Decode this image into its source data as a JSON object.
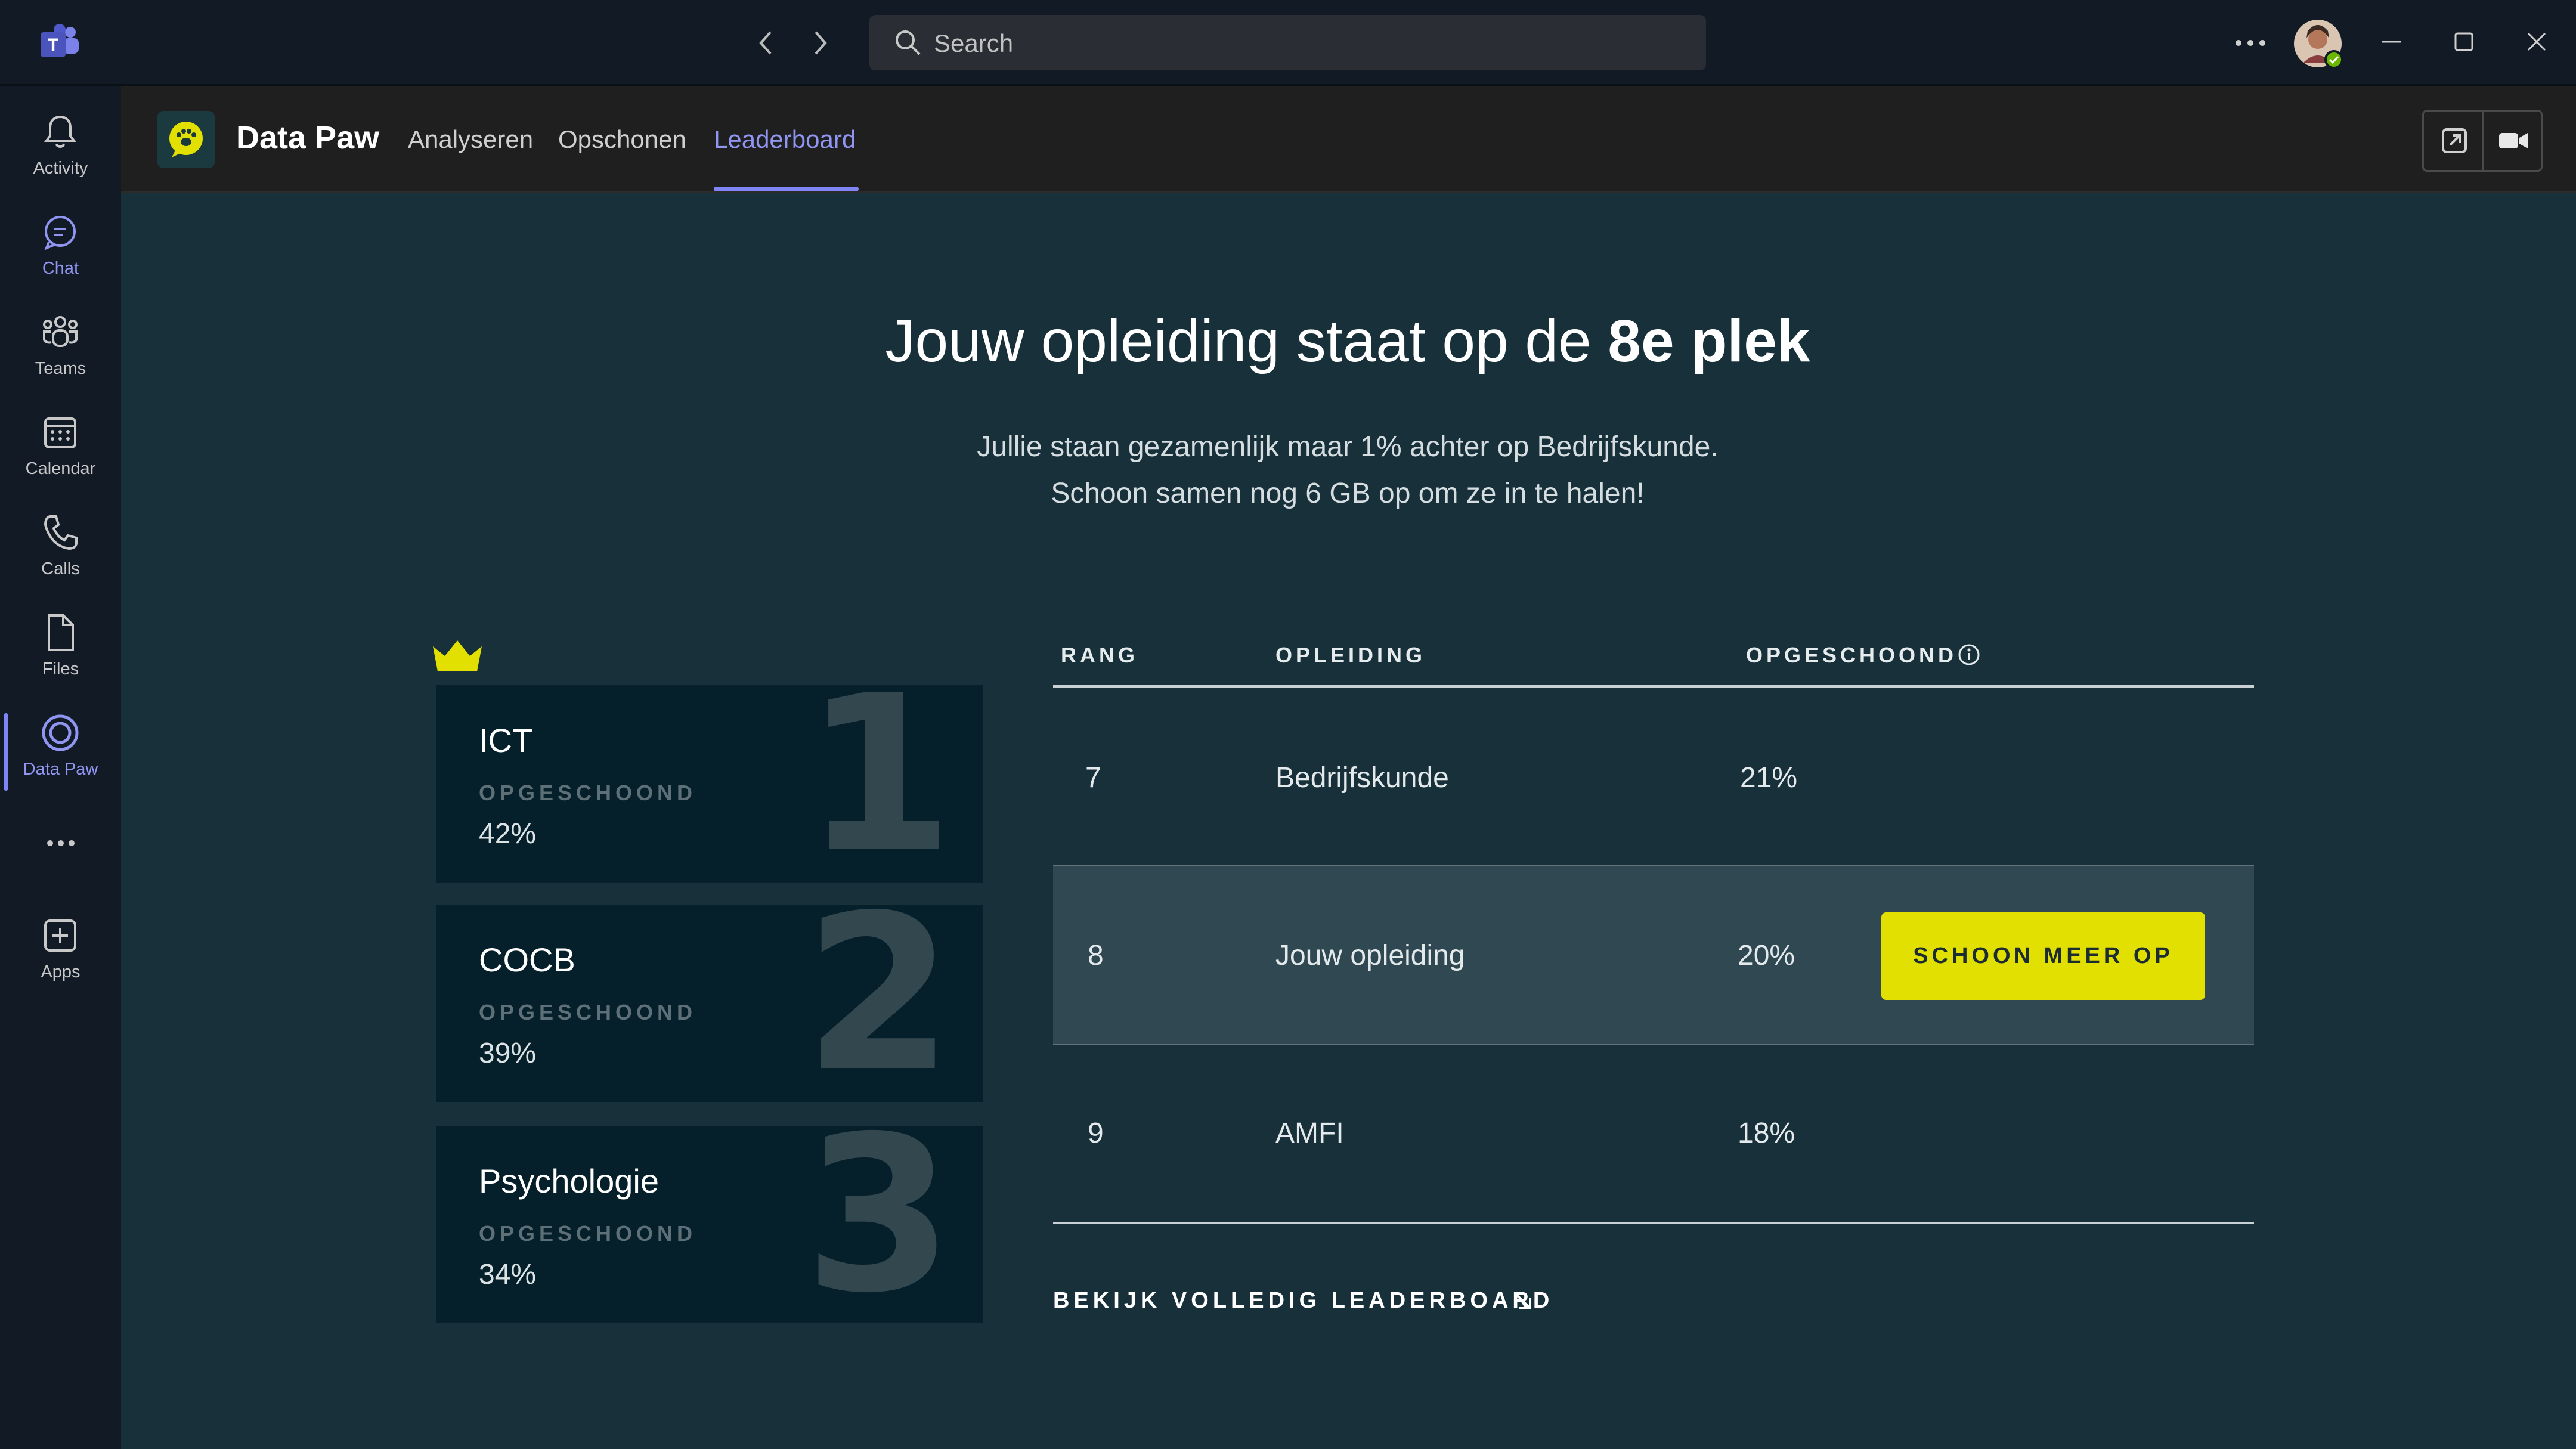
{
  "titlebar": {
    "search_placeholder": "Search",
    "icons": [
      "teams-logo-icon",
      "back-arrow-icon",
      "forward-arrow-icon",
      "search-icon",
      "more-icon",
      "avatar",
      "minimize-icon",
      "maximize-icon",
      "close-icon"
    ]
  },
  "rail": {
    "items": [
      {
        "label": "Activity",
        "icon": "bell-icon"
      },
      {
        "label": "Chat",
        "icon": "chat-icon"
      },
      {
        "label": "Teams",
        "icon": "teams-icon"
      },
      {
        "label": "Calendar",
        "icon": "calendar-icon"
      },
      {
        "label": "Calls",
        "icon": "phone-icon"
      },
      {
        "label": "Files",
        "icon": "file-icon"
      },
      {
        "label": "Data Paw",
        "icon": "data-paw-icon"
      },
      {
        "label": "Apps",
        "icon": "plus-icon"
      }
    ],
    "active": "Data Paw"
  },
  "app": {
    "name": "Data Paw",
    "tabs": [
      "Analyseren",
      "Opschonen",
      "Leaderboard"
    ],
    "active_tab": "Leaderboard",
    "icons": [
      "popout-icon",
      "video-icon"
    ]
  },
  "headline": {
    "prefix": "Jouw opleiding staat op de ",
    "highlight": "8e plek",
    "line1": "Jullie staan gezamenlijk maar 1% achter op Bedrijfskunde.",
    "line2": "Schoon samen nog 6 GB op om ze in te halen!"
  },
  "podium": [
    {
      "rank": "1",
      "name": "ICT",
      "label": "OPGESCHOOND",
      "value": "42%"
    },
    {
      "rank": "2",
      "name": "COCB",
      "label": "OPGESCHOOND",
      "value": "39%"
    },
    {
      "rank": "3",
      "name": "Psychologie",
      "label": "OPGESCHOOND",
      "value": "34%"
    }
  ],
  "table": {
    "headers": [
      "RANG",
      "OPLEIDING",
      "OPGESCHOOND"
    ],
    "rows": [
      {
        "rank": "7",
        "name": "Bedrijfskunde",
        "value": "21%"
      },
      {
        "rank": "8",
        "name": "Jouw opleiding",
        "value": "20%",
        "button": "SCHOON MEER OP"
      },
      {
        "rank": "9",
        "name": "AMFI",
        "value": "18%"
      }
    ],
    "footer_link": "BEKIJK VOLLEDIG LEADERBOARD"
  },
  "colors": {
    "accent": "#8f95f0",
    "brand_yellow": "#e2e000",
    "background": "#17303a",
    "card": "#06202b",
    "highlight_row": "#2f4852"
  }
}
